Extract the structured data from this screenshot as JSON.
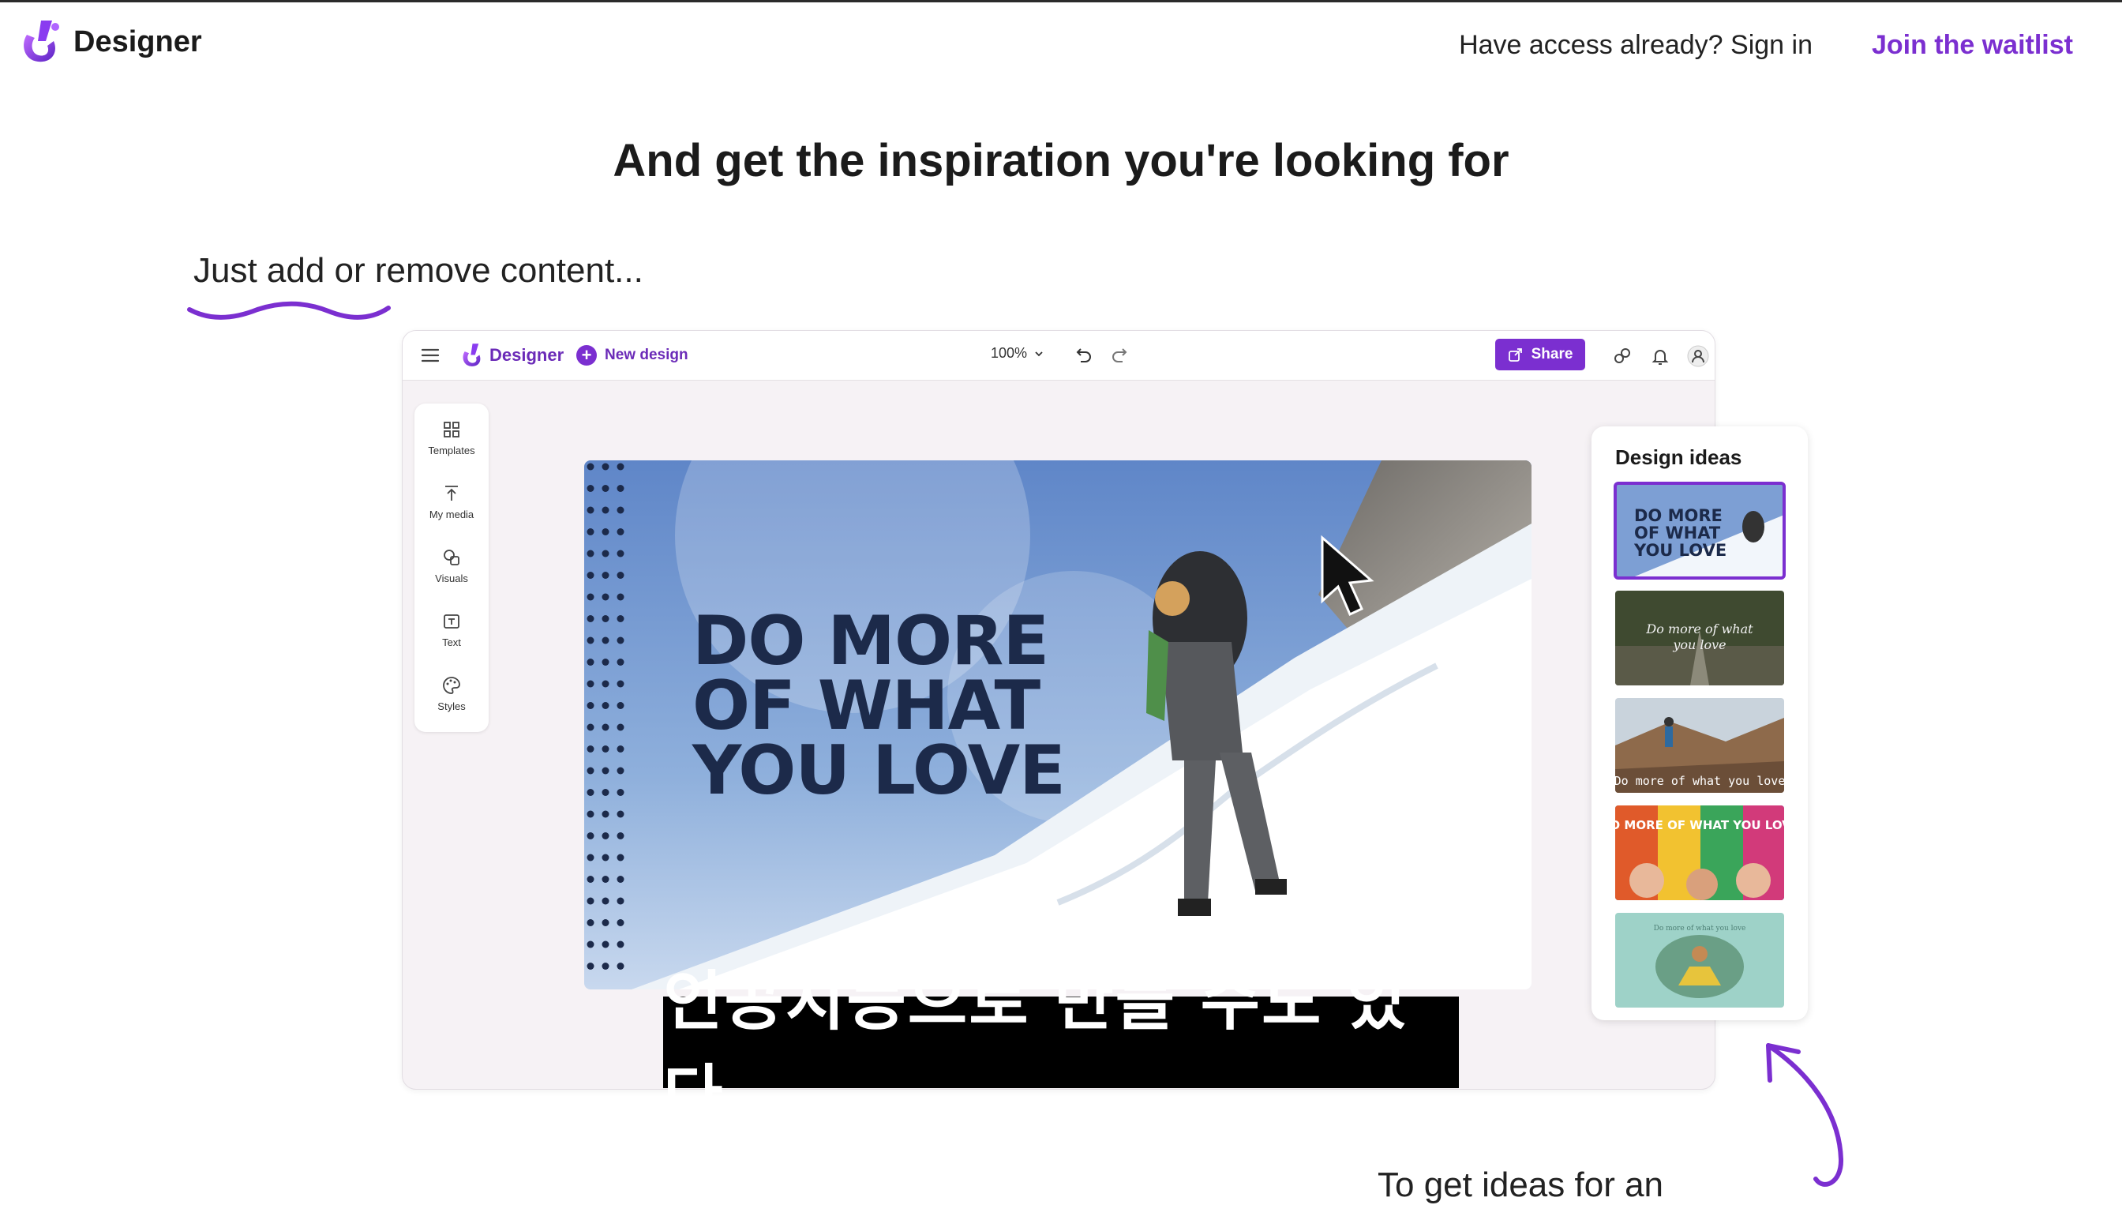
{
  "header": {
    "brand": "Designer",
    "signin_text": "Have access already? Sign in",
    "waitlist_text": "Join the waitlist"
  },
  "headline": "And get the inspiration you're looking for",
  "callout": "Just add or remove content...",
  "app": {
    "brand": "Designer",
    "new_design": "New design",
    "zoom": "100%",
    "share": "Share",
    "rail": [
      {
        "label": "Templates",
        "icon": "templates-icon"
      },
      {
        "label": "My media",
        "icon": "upload-icon"
      },
      {
        "label": "Visuals",
        "icon": "shapes-icon"
      },
      {
        "label": "Text",
        "icon": "text-icon"
      },
      {
        "label": "Styles",
        "icon": "palette-icon"
      }
    ],
    "canvas": {
      "headline_lines": [
        "DO MORE",
        "OF WHAT",
        "YOU LOVE"
      ]
    },
    "design_ideas": {
      "title": "Design ideas",
      "thumbs": [
        {
          "text_lines": [
            "DO MORE",
            "OF WHAT",
            "YOU LOVE"
          ],
          "selected": true
        },
        {
          "text_lines": [
            "Do more of what",
            "you love"
          ]
        },
        {
          "text_lines": [
            "Do more of what you love"
          ]
        },
        {
          "text_lines": [
            "DO MORE OF WHAT YOU LOVE"
          ]
        },
        {
          "text_lines": [
            "Do more of what you love"
          ]
        }
      ]
    }
  },
  "caption": "인공지능으로 만들 수도 있다",
  "bottom_text": "To get ideas for an",
  "colors": {
    "accent": "#7b2fd0",
    "canvas_text": "#1c2a4a"
  }
}
